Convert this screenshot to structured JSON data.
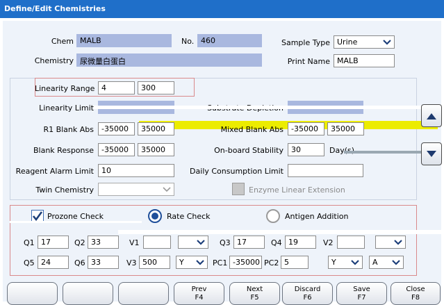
{
  "window": {
    "title": "Define/Edit Chemistries"
  },
  "header": {
    "chem_label": "Chem",
    "chem_value": "MALB",
    "no_label": "No.",
    "no_value": "460",
    "sample_type_label": "Sample Type",
    "sample_type_value": "Urine",
    "chemistry_label": "Chemistry",
    "chemistry_value": "尿微量白蛋白",
    "print_name_label": "Print Name",
    "print_name_value": "MALB"
  },
  "params": {
    "linearity_range_label": "Linearity Range",
    "linearity_low": "4",
    "linearity_high": "300",
    "linearity_limit_label": "Linearity Limit",
    "substrate_depletion_label": "Substrate Depletion",
    "r1_blank_abs_label": "R1 Blank Abs",
    "r1_blank_abs_low": "-35000",
    "r1_blank_abs_high": "35000",
    "mixed_blank_abs_label": "Mixed Blank Abs",
    "mixed_blank_abs_low": "-35000",
    "mixed_blank_abs_high": "35000",
    "blank_response_label": "Blank Response",
    "blank_response_low": "-35000",
    "blank_response_high": "35000",
    "onboard_stability_label": "On-board Stability",
    "onboard_stability_value": "30",
    "onboard_stability_unit": "Day(s)",
    "reagent_alarm_label": "Reagent Alarm Limit",
    "reagent_alarm_value": "10",
    "daily_consumption_label": "Daily Consumption Limit",
    "daily_consumption_value": "",
    "twin_chemistry_label": "Twin Chemistry",
    "twin_chemistry_value": "",
    "enzyme_linear_label": "Enzyme Linear Extension"
  },
  "checks": {
    "prozone_label": "Prozone Check",
    "rate_label": "Rate Check",
    "antigen_label": "Antigen Addition"
  },
  "qfields": {
    "q1_label": "Q1",
    "q1_value": "17",
    "q2_label": "Q2",
    "q2_value": "33",
    "v1_label": "V1",
    "v1_value": "",
    "q3_label": "Q3",
    "q3_value": "17",
    "q4_label": "Q4",
    "q4_value": "19",
    "v2_label": "V2",
    "v2_value": "",
    "q5_label": "Q5",
    "q5_value": "24",
    "q6_label": "Q6",
    "q6_value": "33",
    "v3_label": "V3",
    "v3_value": "500",
    "v3_select": "Y",
    "pc1_label": "PC1",
    "pc1_value": "-35000",
    "pc2_label": "PC2",
    "pc2_value": "5",
    "select_y": "Y",
    "select_a": "A"
  },
  "footer": {
    "prev_label": "Prev",
    "prev_key": "F4",
    "next_label": "Next",
    "next_key": "F5",
    "discard_label": "Discard",
    "discard_key": "F6",
    "save_label": "Save",
    "save_key": "F7",
    "close_label": "Close",
    "close_key": "F8"
  },
  "icons": {
    "up": "arrow-up-icon",
    "down": "arrow-down-icon",
    "dropdown": "chevron-down-icon"
  },
  "colors": {
    "titlebar": "#1f6fc9",
    "field_fill": "#a9b8df",
    "group_border": "#d9898b",
    "highlight": "#ecec00"
  }
}
